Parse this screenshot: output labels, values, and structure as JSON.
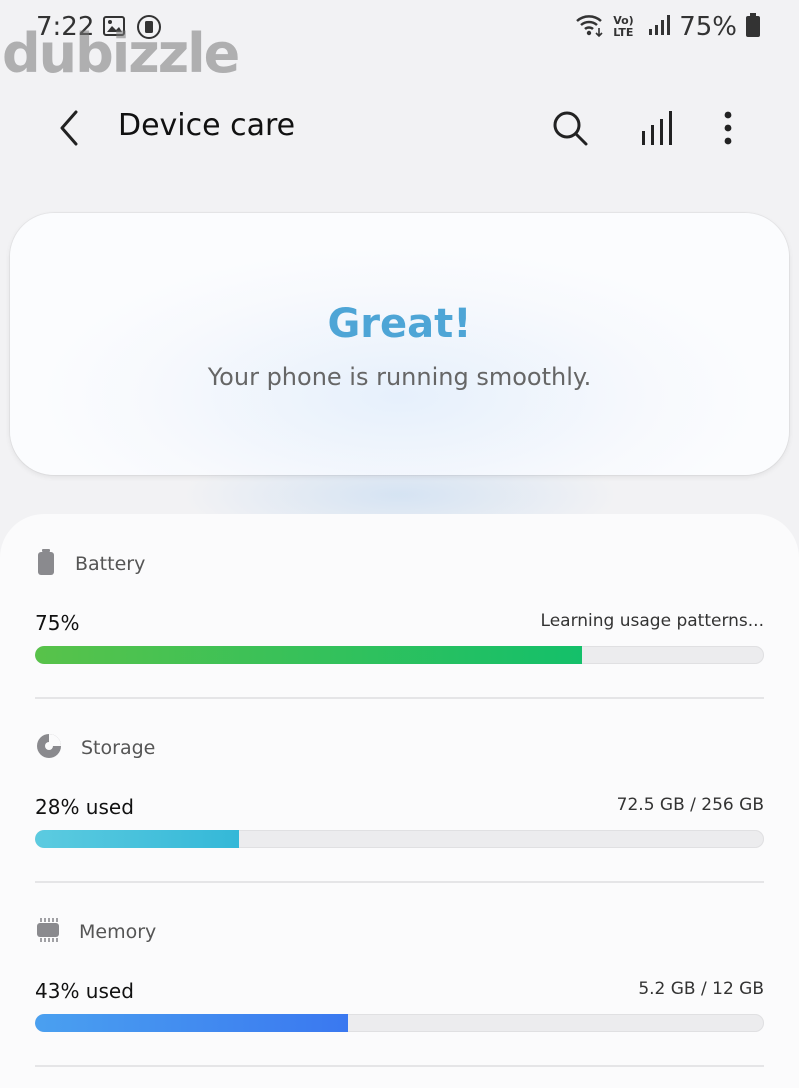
{
  "status_bar": {
    "time": "7:22",
    "battery_percent": "75%",
    "network": "Vo) LTE"
  },
  "watermark": "dubizzle",
  "app_bar": {
    "title": "Device care",
    "back_icon": "chevron-left-icon",
    "actions": [
      "search-icon",
      "signal-bars-icon",
      "more-vertical-icon"
    ]
  },
  "hero": {
    "headline": "Great!",
    "message": "Your phone is running smoothly.",
    "accent_color": "#4ea5d6"
  },
  "sections": [
    {
      "id": "battery",
      "icon": "battery-icon",
      "label": "Battery",
      "value": "75%",
      "detail": "Learning usage patterns...",
      "progress": 0.75,
      "color_start": "#58c24a",
      "color_end": "#14c06a"
    },
    {
      "id": "storage",
      "icon": "pie-chart-icon",
      "label": "Storage",
      "value": "28% used",
      "detail": "72.5 GB / 256 GB",
      "progress": 0.28,
      "color_start": "#5ccbe0",
      "color_end": "#34b8d8"
    },
    {
      "id": "memory",
      "icon": "memory-chip-icon",
      "label": "Memory",
      "value": "43% used",
      "detail": "5.2 GB / 12 GB",
      "progress": 0.43,
      "color_start": "#4aa0f0",
      "color_end": "#3a78f0"
    }
  ]
}
